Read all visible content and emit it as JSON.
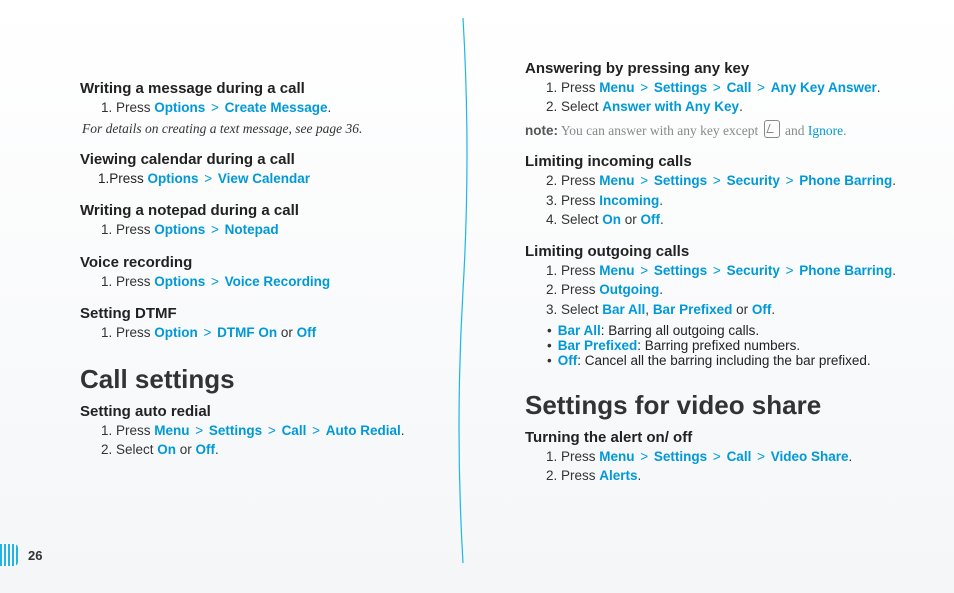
{
  "page_number": "26",
  "left": {
    "s1": {
      "title": "Writing a message during a call",
      "step1_prefix": "Press ",
      "step1_opt": "Options",
      "step1_sep": " > ",
      "step1_act": "Create Message",
      "step1_dot": ".",
      "detail": "For details on creating a text message, see page 36."
    },
    "s2": {
      "title": "Viewing calendar during a call",
      "line1": "1.Press ",
      "opt": "Options",
      "sep": " > ",
      "act": "View Calendar"
    },
    "s3": {
      "title": "Writing a notepad during a call",
      "step1_prefix": "Press ",
      "opt": "Options",
      "sep": " > ",
      "act": "Notepad"
    },
    "s4": {
      "title": "Voice recording",
      "step1_prefix": "Press ",
      "opt": "Options",
      "sep": " > ",
      "act": "Voice Recording"
    },
    "s5": {
      "title": "Setting DTMF",
      "step1_prefix": "Press ",
      "opt": "Option",
      "sep": " > ",
      "act": "DTMF On",
      "or": " or ",
      "off": "Off"
    },
    "h2": "Call settings",
    "s6": {
      "title": "Setting auto redial",
      "l1_prefix": "Press ",
      "l1_menu": "Menu",
      "sep": " > ",
      "l1_settings": "Settings",
      "l1_call": "Call",
      "l1_auto": "Auto Redial",
      "l1_dot": ".",
      "l2_prefix": "Select ",
      "l2_on": "On",
      "l2_or": " or ",
      "l2_off": "Off",
      "l2_dot": "."
    }
  },
  "right": {
    "s1": {
      "title": "Answering by pressing any key",
      "l1_prefix": "Press ",
      "menu": "Menu",
      "sep": " > ",
      "settings": "Settings",
      "call": "Call",
      "anykey": "Any Key Answer",
      "dot": ".",
      "l2_prefix": "Select ",
      "l2_val": "Answer with Any Key",
      "note_label": "note:",
      "note_text_a": " You can answer with any key except ",
      "note_and": " and ",
      "note_ignore": "Ignore",
      "note_dot": "."
    },
    "s2": {
      "title": "Limiting incoming calls",
      "l2_prefix": "Press ",
      "menu": "Menu",
      "sep": " > ",
      "settings": "Settings",
      "security": "Security",
      "barring": "Phone Barring",
      "dot": ".",
      "l3_prefix": "Press ",
      "l3_val": "Incoming",
      "l4_prefix": "Select ",
      "l4_on": "On",
      "l4_or": " or ",
      "l4_off": "Off"
    },
    "s3": {
      "title": "Limiting outgoing calls",
      "l1_prefix": "Press ",
      "menu": "Menu",
      "sep": " > ",
      "settings": "Settings",
      "security": "Security",
      "barring": "Phone Barring",
      "dot": ".",
      "l2_prefix": "Press ",
      "l2_val": "Outgoing",
      "l3_prefix": "Select ",
      "l3_a": "Bar All",
      "l3_comma": ", ",
      "l3_b": "Bar Prefixed",
      "l3_or": " or ",
      "l3_c": "Off",
      "b1_a": "Bar All",
      "b1_t": ": Barring all outgoing calls.",
      "b2_a": "Bar Prefixed",
      "b2_t": ": Barring prefixed numbers.",
      "b3_a": "Off",
      "b3_t": ": Cancel all the barring including the bar prefixed."
    },
    "h2": "Settings for video share",
    "s4": {
      "title": "Turning the alert on/ off",
      "l1_prefix": "Press ",
      "menu": "Menu",
      "sep": " > ",
      "settings": "Settings",
      "call": "Call",
      "vs": "Video Share",
      "dot": ".",
      "l2_prefix": "Press ",
      "l2_val": "Alerts"
    }
  }
}
